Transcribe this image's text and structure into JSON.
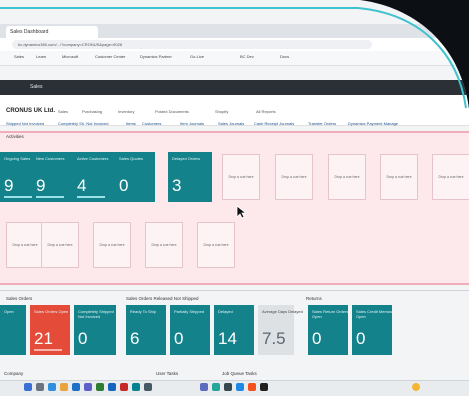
{
  "browser": {
    "tab_title": "Sales Dashboard",
    "address": "bc.dynamics365.com/.../?company=CRONUS&page=9026",
    "bookmarks": [
      "Sales",
      "Learn",
      "Microsoft",
      "Customer Center",
      "Dynamics Partner",
      "Go-Live",
      "BC Dev",
      "Docs"
    ]
  },
  "breadcrumb": {
    "title": "Sales"
  },
  "app": {
    "company": "CRONUS UK Ltd.",
    "menu": [
      "Sales",
      "Purchasing",
      "Inventory",
      "Posted Documents",
      "Shopify",
      "All Reports"
    ],
    "actions": [
      "Shipped Not Invoiced",
      "Completely Sh. Not Invoiced",
      "Items",
      "Customers",
      "Item Journals",
      "Sales Journals",
      "Cash Receipt Journals",
      "Transfer Orders",
      "Dynamics Payment Manage"
    ]
  },
  "activities": {
    "label": "Activities",
    "cues": [
      {
        "label": "Ongoing Sales",
        "value": "9",
        "style": "teal"
      },
      {
        "label": "New Customers",
        "value": "9",
        "style": "teal"
      },
      {
        "label": "Active Customers",
        "value": "4",
        "style": "teal"
      },
      {
        "label": "Sales Quotes",
        "value": "0",
        "style": "teal"
      },
      {
        "label": "Delayed Orders",
        "value": "3",
        "style": "teal"
      }
    ],
    "empty_label": "Drop a cue here"
  },
  "sales_section": {
    "label": "Sales Orders",
    "sub_label": "Sales Orders Released Not Shipped",
    "returns_label": "Returns",
    "cues": [
      {
        "label": "Open",
        "value": "",
        "style": "teal"
      },
      {
        "label": "Sales Orders Open",
        "value": "21",
        "style": "red"
      },
      {
        "label": "Completely Shipped Not Invoiced",
        "value": "0",
        "style": "teal"
      },
      {
        "label": "Ready To Ship",
        "value": "6",
        "style": "teal"
      },
      {
        "label": "Partially Shipped",
        "value": "0",
        "style": "teal"
      },
      {
        "label": "Delayed",
        "value": "14",
        "style": "teal"
      },
      {
        "label": "Average Days Delayed",
        "value": "7.5",
        "style": "gray"
      },
      {
        "label": "Sales Return Orders Open",
        "value": "0",
        "style": "teal"
      },
      {
        "label": "Sales Credit Memos Open",
        "value": "0",
        "style": "teal"
      }
    ]
  },
  "bottom": {
    "labels": [
      "Company",
      "User Tasks",
      "Job Queue Tasks"
    ]
  },
  "colors": {
    "teal": "#13828b",
    "red": "#e44b38",
    "pink": "#fde9ec",
    "arc": "#3fc2cf"
  }
}
